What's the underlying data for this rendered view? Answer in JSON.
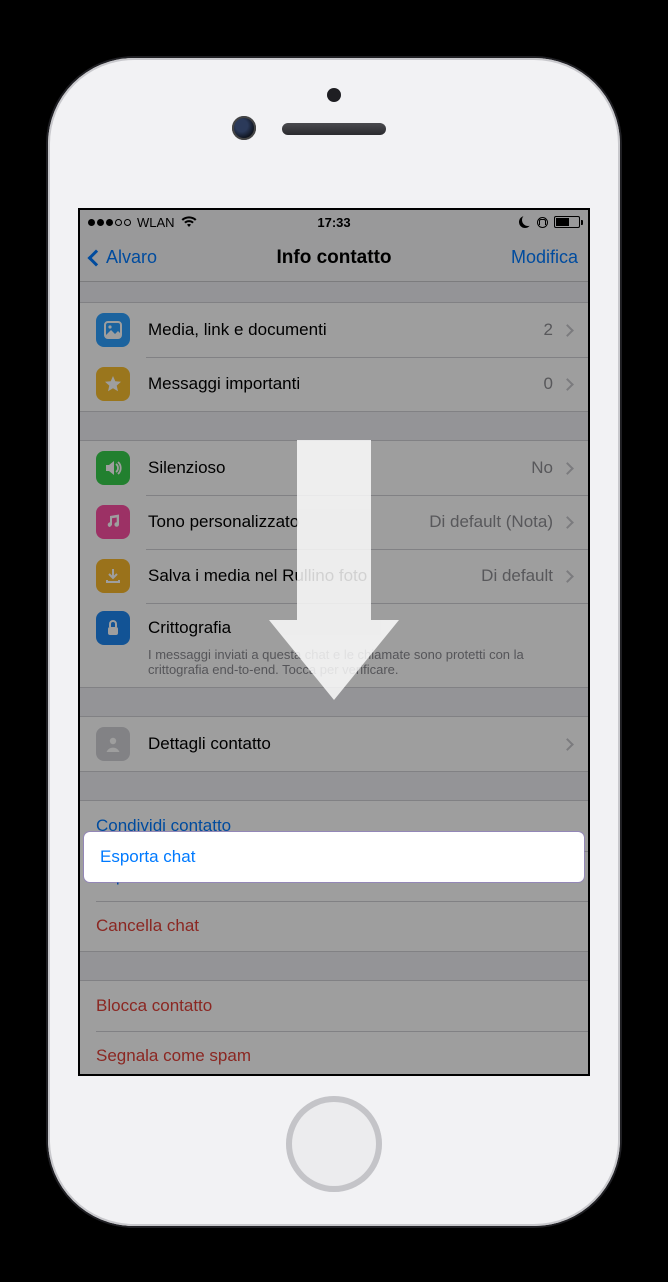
{
  "status": {
    "carrier": "WLAN",
    "time": "17:33"
  },
  "nav": {
    "back": "Alvaro",
    "title": "Info contatto",
    "edit": "Modifica"
  },
  "rows": {
    "media": {
      "label": "Media, link e documenti",
      "value": "2"
    },
    "starred": {
      "label": "Messaggi importanti",
      "value": "0"
    },
    "mute": {
      "label": "Silenzioso",
      "value": "No"
    },
    "tone": {
      "label": "Tono personalizzato",
      "value": "Di default (Nota)"
    },
    "save": {
      "label": "Salva i media nel Rullino foto",
      "value": "Di default"
    },
    "enc": {
      "label": "Crittografia",
      "sub": "I messaggi inviati a questa chat e le chiamate sono protetti con la crittografia end-to-end. Tocca per verificare."
    },
    "details": {
      "label": "Dettagli contatto"
    }
  },
  "actions": {
    "share": "Condividi contatto",
    "export": "Esporta chat",
    "clear": "Cancella chat",
    "block": "Blocca contatto",
    "spam": "Segnala come spam"
  }
}
